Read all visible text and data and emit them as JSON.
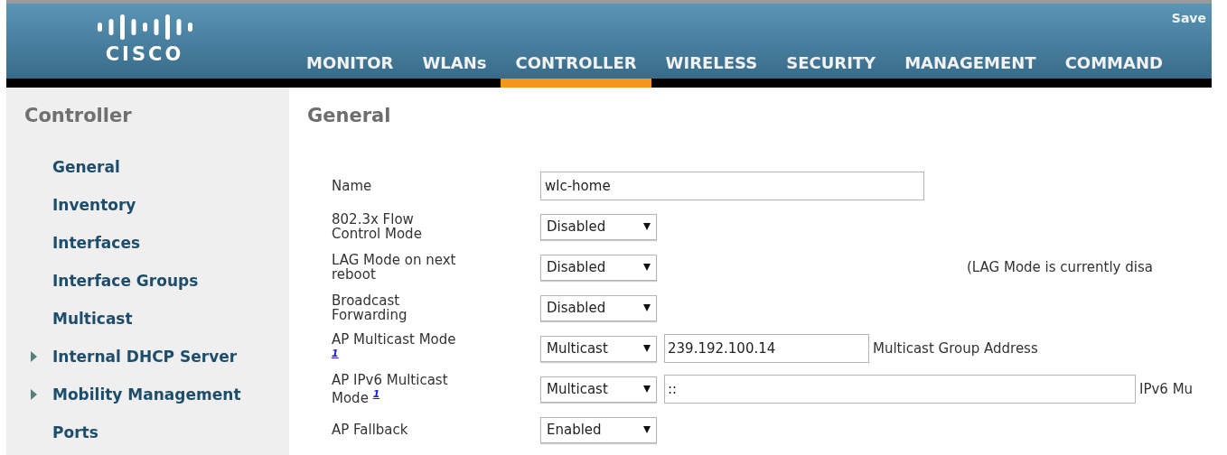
{
  "header": {
    "logo_text": "CISCO",
    "save_link": {
      "label": "Save"
    },
    "menu": [
      {
        "label": "MONITOR",
        "selected": false
      },
      {
        "label": "WLANs",
        "selected": false
      },
      {
        "label": "CONTROLLER",
        "selected": true
      },
      {
        "label": "WIRELESS",
        "selected": false
      },
      {
        "label": "SECURITY",
        "selected": false
      },
      {
        "label": "MANAGEMENT",
        "selected": false
      },
      {
        "label": "COMMAND",
        "selected": false
      }
    ]
  },
  "sidebar": {
    "title": "Controller",
    "items": [
      {
        "label": "General",
        "expandable": false
      },
      {
        "label": "Inventory",
        "expandable": false
      },
      {
        "label": "Interfaces",
        "expandable": false
      },
      {
        "label": "Interface Groups",
        "expandable": false
      },
      {
        "label": "Multicast",
        "expandable": false
      },
      {
        "label": "Internal DHCP Server",
        "expandable": true
      },
      {
        "label": "Mobility Management",
        "expandable": true
      },
      {
        "label": "Ports",
        "expandable": false
      }
    ]
  },
  "page": {
    "title": "General",
    "rows": [
      {
        "label": "Name",
        "control": {
          "kind": "text",
          "value": "wlc-home"
        }
      },
      {
        "label": "802.3x Flow Control Mode",
        "control": {
          "kind": "select",
          "value": "Disabled"
        }
      },
      {
        "label": "LAG Mode on next reboot",
        "control": {
          "kind": "select",
          "value": "Disabled"
        },
        "note": "(LAG Mode is currently disa"
      },
      {
        "label": "Broadcast Forwarding",
        "control": {
          "kind": "select",
          "value": "Disabled"
        }
      },
      {
        "label": "AP Multicast Mode",
        "footnote": "1",
        "control": {
          "kind": "select",
          "value": "Multicast"
        },
        "address": {
          "value": "239.192.100.14",
          "kind": "short",
          "caption": "Multicast Group Address"
        }
      },
      {
        "label": "AP IPv6 Multicast Mode",
        "footnote": "1",
        "control": {
          "kind": "select",
          "value": "Multicast"
        },
        "address": {
          "value": "::",
          "kind": "long",
          "caption": "IPv6 Mu"
        }
      },
      {
        "label": "AP Fallback",
        "control": {
          "kind": "select",
          "value": "Enabled"
        }
      }
    ]
  }
}
